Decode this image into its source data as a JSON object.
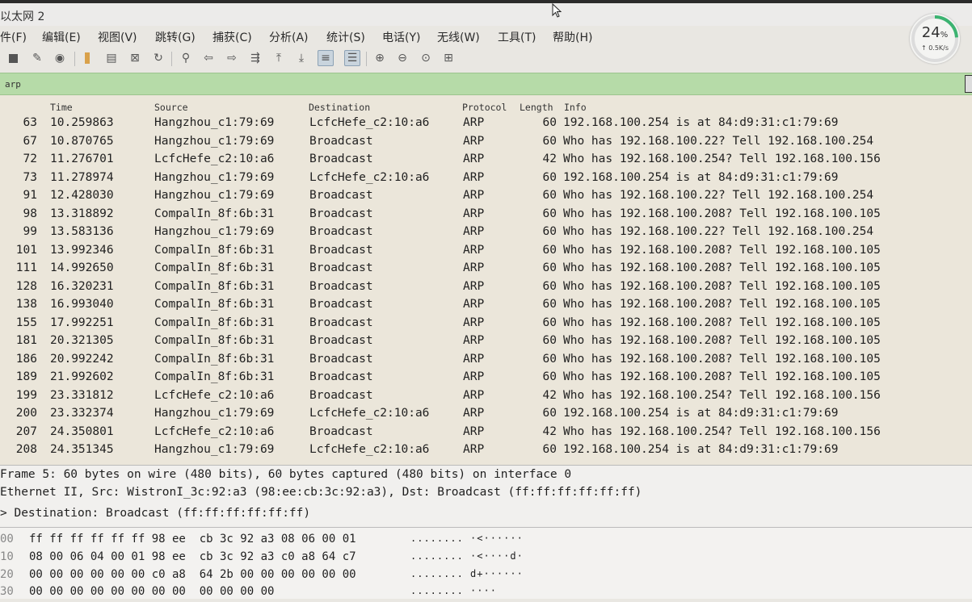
{
  "window": {
    "title": "以太网 2"
  },
  "menu": [
    "件(F)",
    "编辑(E)",
    "视图(V)",
    "跳转(G)",
    "捕获(C)",
    "分析(A)",
    "统计(S)",
    "电话(Y)",
    "无线(W)",
    "工具(T)",
    "帮助(H)"
  ],
  "gauge": {
    "percent_label": "24",
    "percent_sign": "%",
    "percent_value": 24,
    "rate": "↑ 0.5K/s",
    "color": "#3cb371"
  },
  "filter": {
    "value": "arp"
  },
  "columns": {
    "time": "Time",
    "source": "Source",
    "destination": "Destination",
    "protocol": "Protocol",
    "length": "Length",
    "info": "Info"
  },
  "packets": [
    {
      "no": "63",
      "time": "10.259863",
      "src": "Hangzhou_c1:79:69",
      "dst": "LcfcHefe_c2:10:a6",
      "proto": "ARP",
      "len": "60",
      "info": "192.168.100.254 is at 84:d9:31:c1:79:69"
    },
    {
      "no": "67",
      "time": "10.870765",
      "src": "Hangzhou_c1:79:69",
      "dst": "Broadcast",
      "proto": "ARP",
      "len": "60",
      "info": "Who has 192.168.100.22? Tell 192.168.100.254"
    },
    {
      "no": "72",
      "time": "11.276701",
      "src": "LcfcHefe_c2:10:a6",
      "dst": "Broadcast",
      "proto": "ARP",
      "len": "42",
      "info": "Who has 192.168.100.254? Tell 192.168.100.156"
    },
    {
      "no": "73",
      "time": "11.278974",
      "src": "Hangzhou_c1:79:69",
      "dst": "LcfcHefe_c2:10:a6",
      "proto": "ARP",
      "len": "60",
      "info": "192.168.100.254 is at 84:d9:31:c1:79:69"
    },
    {
      "no": "91",
      "time": "12.428030",
      "src": "Hangzhou_c1:79:69",
      "dst": "Broadcast",
      "proto": "ARP",
      "len": "60",
      "info": "Who has 192.168.100.22? Tell 192.168.100.254"
    },
    {
      "no": "98",
      "time": "13.318892",
      "src": "CompalIn_8f:6b:31",
      "dst": "Broadcast",
      "proto": "ARP",
      "len": "60",
      "info": "Who has 192.168.100.208? Tell 192.168.100.105"
    },
    {
      "no": "99",
      "time": "13.583136",
      "src": "Hangzhou_c1:79:69",
      "dst": "Broadcast",
      "proto": "ARP",
      "len": "60",
      "info": "Who has 192.168.100.22? Tell 192.168.100.254"
    },
    {
      "no": "101",
      "time": "13.992346",
      "src": "CompalIn_8f:6b:31",
      "dst": "Broadcast",
      "proto": "ARP",
      "len": "60",
      "info": "Who has 192.168.100.208? Tell 192.168.100.105"
    },
    {
      "no": "111",
      "time": "14.992650",
      "src": "CompalIn_8f:6b:31",
      "dst": "Broadcast",
      "proto": "ARP",
      "len": "60",
      "info": "Who has 192.168.100.208? Tell 192.168.100.105"
    },
    {
      "no": "128",
      "time": "16.320231",
      "src": "CompalIn_8f:6b:31",
      "dst": "Broadcast",
      "proto": "ARP",
      "len": "60",
      "info": "Who has 192.168.100.208? Tell 192.168.100.105"
    },
    {
      "no": "138",
      "time": "16.993040",
      "src": "CompalIn_8f:6b:31",
      "dst": "Broadcast",
      "proto": "ARP",
      "len": "60",
      "info": "Who has 192.168.100.208? Tell 192.168.100.105"
    },
    {
      "no": "155",
      "time": "17.992251",
      "src": "CompalIn_8f:6b:31",
      "dst": "Broadcast",
      "proto": "ARP",
      "len": "60",
      "info": "Who has 192.168.100.208? Tell 192.168.100.105"
    },
    {
      "no": "181",
      "time": "20.321305",
      "src": "CompalIn_8f:6b:31",
      "dst": "Broadcast",
      "proto": "ARP",
      "len": "60",
      "info": "Who has 192.168.100.208? Tell 192.168.100.105"
    },
    {
      "no": "186",
      "time": "20.992242",
      "src": "CompalIn_8f:6b:31",
      "dst": "Broadcast",
      "proto": "ARP",
      "len": "60",
      "info": "Who has 192.168.100.208? Tell 192.168.100.105"
    },
    {
      "no": "189",
      "time": "21.992602",
      "src": "CompalIn_8f:6b:31",
      "dst": "Broadcast",
      "proto": "ARP",
      "len": "60",
      "info": "Who has 192.168.100.208? Tell 192.168.100.105"
    },
    {
      "no": "199",
      "time": "23.331812",
      "src": "LcfcHefe_c2:10:a6",
      "dst": "Broadcast",
      "proto": "ARP",
      "len": "42",
      "info": "Who has 192.168.100.254? Tell 192.168.100.156"
    },
    {
      "no": "200",
      "time": "23.332374",
      "src": "Hangzhou_c1:79:69",
      "dst": "LcfcHefe_c2:10:a6",
      "proto": "ARP",
      "len": "60",
      "info": "192.168.100.254 is at 84:d9:31:c1:79:69"
    },
    {
      "no": "207",
      "time": "24.350801",
      "src": "LcfcHefe_c2:10:a6",
      "dst": "Broadcast",
      "proto": "ARP",
      "len": "42",
      "info": "Who has 192.168.100.254? Tell 192.168.100.156"
    },
    {
      "no": "208",
      "time": "24.351345",
      "src": "Hangzhou_c1:79:69",
      "dst": "LcfcHefe_c2:10:a6",
      "proto": "ARP",
      "len": "60",
      "info": "192.168.100.254 is at 84:d9:31:c1:79:69"
    }
  ],
  "details": [
    "Frame 5: 60 bytes on wire (480 bits), 60 bytes captured (480 bits) on interface 0",
    "Ethernet II, Src: WistronI_3c:92:a3 (98:ee:cb:3c:92:a3), Dst: Broadcast (ff:ff:ff:ff:ff:ff)",
    "> Destination: Broadcast (ff:ff:ff:ff:ff:ff)"
  ],
  "bytes": [
    {
      "offset": "00",
      "hex": "ff ff ff ff ff ff 98 ee  cb 3c 92 a3 08 06 00 01",
      "ascii": "........ ·<······"
    },
    {
      "offset": "10",
      "hex": "08 00 06 04 00 01 98 ee  cb 3c 92 a3 c0 a8 64 c7",
      "ascii": "........ ·<····d·"
    },
    {
      "offset": "20",
      "hex": "00 00 00 00 00 00 c0 a8  64 2b 00 00 00 00 00 00",
      "ascii": "........ d+······"
    },
    {
      "offset": "30",
      "hex": "00 00 00 00 00 00 00 00  00 00 00 00",
      "ascii": "........ ····"
    }
  ]
}
